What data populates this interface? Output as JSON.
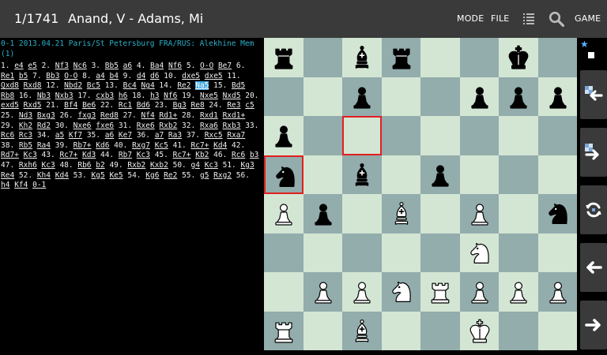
{
  "header": {
    "game_counter": "1/1741",
    "players": "Anand, V - Adams, Mi",
    "mode_label": "MODE",
    "file_label": "FILE",
    "game_label": "GAME"
  },
  "game": {
    "header_text": "0-1 2013.04.21 Paris/St Petersburg FRA/RUS: Alekhine Mem (1)",
    "moves": [
      {
        "t": "1."
      },
      {
        "m": "e4"
      },
      {
        "m": "e5"
      },
      {
        "t": "2."
      },
      {
        "m": "Nf3"
      },
      {
        "m": "Nc6"
      },
      {
        "t": "3."
      },
      {
        "m": "Bb5"
      },
      {
        "m": "a6"
      },
      {
        "t": "4."
      },
      {
        "m": "Ba4"
      },
      {
        "m": "Nf6"
      },
      {
        "t": "5."
      },
      {
        "m": "O-O"
      },
      {
        "m": "Be7"
      },
      {
        "t": "6."
      },
      {
        "m": "Re1"
      },
      {
        "m": "b5"
      },
      {
        "t": "7."
      },
      {
        "m": "Bb3"
      },
      {
        "m": "O-O"
      },
      {
        "t": "8."
      },
      {
        "m": "a4"
      },
      {
        "m": "b4"
      },
      {
        "t": "9."
      },
      {
        "m": "d4"
      },
      {
        "m": "d6"
      },
      {
        "t": "10."
      },
      {
        "m": "dxe5"
      },
      {
        "m": "dxe5"
      },
      {
        "t": "11."
      },
      {
        "m": "Qxd8"
      },
      {
        "m": "Rxd8"
      },
      {
        "t": "12."
      },
      {
        "m": "Nbd2"
      },
      {
        "m": "Bc5"
      },
      {
        "t": "13."
      },
      {
        "m": "Bc4"
      },
      {
        "m": "Ng4"
      },
      {
        "t": "14."
      },
      {
        "m": "Re2"
      },
      {
        "m": "Na5",
        "cur": true
      },
      {
        "t": "15."
      },
      {
        "m": "Bd5"
      },
      {
        "m": "Rb8"
      },
      {
        "t": "16."
      },
      {
        "m": "Nb3"
      },
      {
        "m": "Nxb3"
      },
      {
        "t": "17."
      },
      {
        "m": "cxb3"
      },
      {
        "m": "h6"
      },
      {
        "t": "18."
      },
      {
        "m": "h3"
      },
      {
        "m": "Nf6"
      },
      {
        "t": "19."
      },
      {
        "m": "Nxe5"
      },
      {
        "m": "Nxd5"
      },
      {
        "t": "20."
      },
      {
        "m": "exd5"
      },
      {
        "m": "Rxd5"
      },
      {
        "t": "21."
      },
      {
        "m": "Bf4"
      },
      {
        "m": "Be6"
      },
      {
        "t": "22."
      },
      {
        "m": "Rc1"
      },
      {
        "m": "Bd6"
      },
      {
        "t": "23."
      },
      {
        "m": "Bg3"
      },
      {
        "m": "Re8"
      },
      {
        "t": "24."
      },
      {
        "m": "Re3"
      },
      {
        "m": "c5"
      },
      {
        "t": "25."
      },
      {
        "m": "Nd3"
      },
      {
        "m": "Bxg3"
      },
      {
        "t": "26."
      },
      {
        "m": "fxg3"
      },
      {
        "m": "Red8"
      },
      {
        "t": "27."
      },
      {
        "m": "Nf4"
      },
      {
        "m": "Rd1+"
      },
      {
        "t": "28."
      },
      {
        "m": "Rxd1"
      },
      {
        "m": "Rxd1+"
      },
      {
        "t": "29."
      },
      {
        "m": "Kh2"
      },
      {
        "m": "Rd2"
      },
      {
        "t": "30."
      },
      {
        "m": "Nxe6"
      },
      {
        "m": "fxe6"
      },
      {
        "t": "31."
      },
      {
        "m": "Rxe6"
      },
      {
        "m": "Rxb2"
      },
      {
        "t": "32."
      },
      {
        "m": "Rxa6"
      },
      {
        "m": "Rxb3"
      },
      {
        "t": "33."
      },
      {
        "m": "Rc6"
      },
      {
        "m": "Rc3"
      },
      {
        "t": "34."
      },
      {
        "m": "a5"
      },
      {
        "m": "Kf7"
      },
      {
        "t": "35."
      },
      {
        "m": "a6"
      },
      {
        "m": "Ke7"
      },
      {
        "t": "36."
      },
      {
        "m": "a7"
      },
      {
        "m": "Ra3"
      },
      {
        "t": "37."
      },
      {
        "m": "Rxc5"
      },
      {
        "m": "Rxa7"
      },
      {
        "t": "38."
      },
      {
        "m": "Rb5"
      },
      {
        "m": "Ra4"
      },
      {
        "t": "39."
      },
      {
        "m": "Rb7+"
      },
      {
        "m": "Kd6"
      },
      {
        "t": "40."
      },
      {
        "m": "Rxg7"
      },
      {
        "m": "Kc5"
      },
      {
        "t": "41."
      },
      {
        "m": "Rc7+"
      },
      {
        "m": "Kd4"
      },
      {
        "t": "42."
      },
      {
        "m": "Rd7+"
      },
      {
        "m": "Kc3"
      },
      {
        "t": "43."
      },
      {
        "m": "Rc7+"
      },
      {
        "m": "Kd3"
      },
      {
        "t": "44."
      },
      {
        "m": "Rb7"
      },
      {
        "m": "Kc3"
      },
      {
        "t": "45."
      },
      {
        "m": "Rc7+"
      },
      {
        "m": "Kb2"
      },
      {
        "t": "46."
      },
      {
        "m": "Rc6"
      },
      {
        "m": "b3"
      },
      {
        "t": "47."
      },
      {
        "m": "Rxh6"
      },
      {
        "m": "Kc3"
      },
      {
        "t": "48."
      },
      {
        "m": "Rb6"
      },
      {
        "m": "b2"
      },
      {
        "t": "49."
      },
      {
        "m": "Rxb2"
      },
      {
        "m": "Kxb2"
      },
      {
        "t": "50."
      },
      {
        "m": "g4"
      },
      {
        "m": "Kc3"
      },
      {
        "t": "51."
      },
      {
        "m": "Kg3"
      },
      {
        "m": "Re4"
      },
      {
        "t": "52."
      },
      {
        "m": "Kh4"
      },
      {
        "m": "Kd4"
      },
      {
        "t": "53."
      },
      {
        "m": "Kg5"
      },
      {
        "m": "Ke5"
      },
      {
        "t": "54."
      },
      {
        "m": "Kg6"
      },
      {
        "m": "Re2"
      },
      {
        "t": "55."
      },
      {
        "m": "g5"
      },
      {
        "m": "Rxg2"
      },
      {
        "t": "56."
      },
      {
        "m": "h4"
      },
      {
        "m": "Kf4"
      },
      {
        "m": "0-1"
      }
    ]
  },
  "board": {
    "ranks": [
      "r.br..k.",
      "..p..ppp",
      "p.......",
      "n.b.p...",
      "Pp.B.P.n",
      ".....N..",
      ".PPNRPPP",
      "R.B..K.."
    ],
    "highlight_squares": [
      [
        2,
        2
      ],
      [
        3,
        0
      ]
    ],
    "colors": {
      "light": "#d3e6d4",
      "dark": "#93acac",
      "highlight": "#e21f1f"
    }
  },
  "sidebar": {
    "buttons": [
      {
        "name": "prev-variation-button",
        "icon": "arrow-left-with-board-icon"
      },
      {
        "name": "next-variation-button",
        "icon": "arrow-right-with-board-icon"
      },
      {
        "name": "flip-board-button",
        "icon": "rotate-icon"
      },
      {
        "name": "previous-move-button",
        "icon": "arrow-left-icon"
      },
      {
        "name": "next-move-button",
        "icon": "arrow-right-icon"
      }
    ]
  }
}
